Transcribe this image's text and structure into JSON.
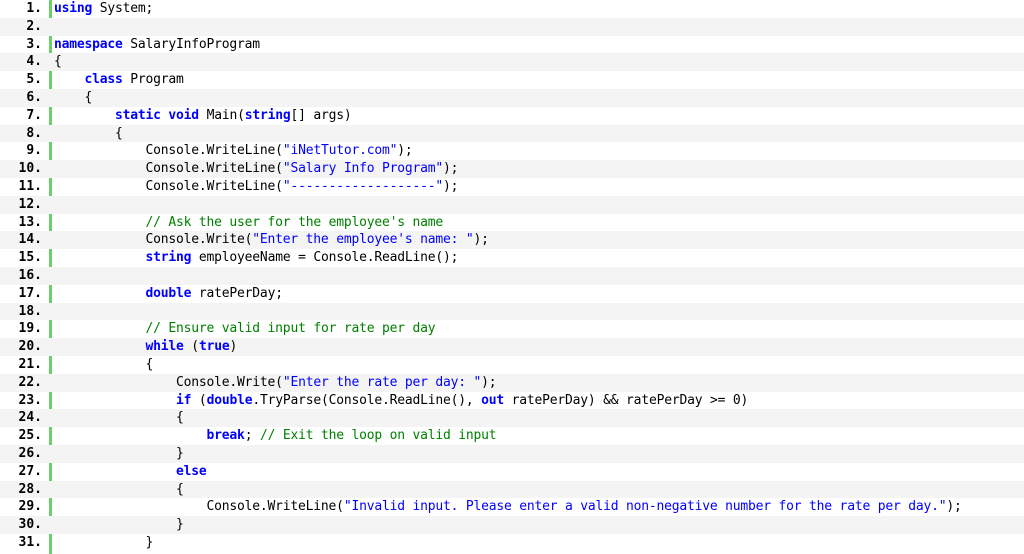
{
  "colors": {
    "keyword": "#0000ff",
    "string": "#0000ff",
    "comment": "#008000",
    "plain": "#000000",
    "gutter_bar": "#6ad16a",
    "stripe": "#f4f4f4"
  },
  "lines": [
    {
      "n": "1.",
      "tokens": [
        {
          "t": "kw",
          "v": "using"
        },
        {
          "t": "pl",
          "v": " System;"
        }
      ]
    },
    {
      "n": "2.",
      "tokens": []
    },
    {
      "n": "3.",
      "tokens": [
        {
          "t": "kw",
          "v": "namespace"
        },
        {
          "t": "pl",
          "v": " SalaryInfoProgram"
        }
      ]
    },
    {
      "n": "4.",
      "tokens": [
        {
          "t": "pl",
          "v": "{"
        }
      ]
    },
    {
      "n": "5.",
      "tokens": [
        {
          "t": "pl",
          "v": "    "
        },
        {
          "t": "kw",
          "v": "class"
        },
        {
          "t": "pl",
          "v": " Program"
        }
      ]
    },
    {
      "n": "6.",
      "tokens": [
        {
          "t": "pl",
          "v": "    {"
        }
      ]
    },
    {
      "n": "7.",
      "tokens": [
        {
          "t": "pl",
          "v": "        "
        },
        {
          "t": "kw",
          "v": "static"
        },
        {
          "t": "pl",
          "v": " "
        },
        {
          "t": "kw",
          "v": "void"
        },
        {
          "t": "pl",
          "v": " Main("
        },
        {
          "t": "kw",
          "v": "string"
        },
        {
          "t": "pl",
          "v": "[] args)"
        }
      ]
    },
    {
      "n": "8.",
      "tokens": [
        {
          "t": "pl",
          "v": "        {"
        }
      ]
    },
    {
      "n": "9.",
      "tokens": [
        {
          "t": "pl",
          "v": "            Console.WriteLine("
        },
        {
          "t": "str",
          "v": "\"iNetTutor.com\""
        },
        {
          "t": "pl",
          "v": ");"
        }
      ]
    },
    {
      "n": "10.",
      "tokens": [
        {
          "t": "pl",
          "v": "            Console.WriteLine("
        },
        {
          "t": "str",
          "v": "\"Salary Info Program\""
        },
        {
          "t": "pl",
          "v": ");"
        }
      ]
    },
    {
      "n": "11.",
      "tokens": [
        {
          "t": "pl",
          "v": "            Console.WriteLine("
        },
        {
          "t": "str",
          "v": "\"-------------------\""
        },
        {
          "t": "pl",
          "v": ");"
        }
      ]
    },
    {
      "n": "12.",
      "tokens": []
    },
    {
      "n": "13.",
      "tokens": [
        {
          "t": "pl",
          "v": "            "
        },
        {
          "t": "cm",
          "v": "// Ask the user for the employee's name"
        }
      ]
    },
    {
      "n": "14.",
      "tokens": [
        {
          "t": "pl",
          "v": "            Console.Write("
        },
        {
          "t": "str",
          "v": "\"Enter the employee's name: \""
        },
        {
          "t": "pl",
          "v": ");"
        }
      ]
    },
    {
      "n": "15.",
      "tokens": [
        {
          "t": "pl",
          "v": "            "
        },
        {
          "t": "kw",
          "v": "string"
        },
        {
          "t": "pl",
          "v": " employeeName = Console.ReadLine();"
        }
      ]
    },
    {
      "n": "16.",
      "tokens": []
    },
    {
      "n": "17.",
      "tokens": [
        {
          "t": "pl",
          "v": "            "
        },
        {
          "t": "kw",
          "v": "double"
        },
        {
          "t": "pl",
          "v": " ratePerDay;"
        }
      ]
    },
    {
      "n": "18.",
      "tokens": []
    },
    {
      "n": "19.",
      "tokens": [
        {
          "t": "pl",
          "v": "            "
        },
        {
          "t": "cm",
          "v": "// Ensure valid input for rate per day"
        }
      ]
    },
    {
      "n": "20.",
      "tokens": [
        {
          "t": "pl",
          "v": "            "
        },
        {
          "t": "kw",
          "v": "while"
        },
        {
          "t": "pl",
          "v": " ("
        },
        {
          "t": "kw",
          "v": "true"
        },
        {
          "t": "pl",
          "v": ")"
        }
      ]
    },
    {
      "n": "21.",
      "tokens": [
        {
          "t": "pl",
          "v": "            {"
        }
      ]
    },
    {
      "n": "22.",
      "tokens": [
        {
          "t": "pl",
          "v": "                Console.Write("
        },
        {
          "t": "str",
          "v": "\"Enter the rate per day: \""
        },
        {
          "t": "pl",
          "v": ");"
        }
      ]
    },
    {
      "n": "23.",
      "tokens": [
        {
          "t": "pl",
          "v": "                "
        },
        {
          "t": "kw",
          "v": "if"
        },
        {
          "t": "pl",
          "v": " ("
        },
        {
          "t": "kw",
          "v": "double"
        },
        {
          "t": "pl",
          "v": ".TryParse(Console.ReadLine(), "
        },
        {
          "t": "kw",
          "v": "out"
        },
        {
          "t": "pl",
          "v": " ratePerDay) && ratePerDay >= 0)"
        }
      ]
    },
    {
      "n": "24.",
      "tokens": [
        {
          "t": "pl",
          "v": "                {"
        }
      ]
    },
    {
      "n": "25.",
      "tokens": [
        {
          "t": "pl",
          "v": "                    "
        },
        {
          "t": "kw",
          "v": "break"
        },
        {
          "t": "pl",
          "v": "; "
        },
        {
          "t": "cm",
          "v": "// Exit the loop on valid input"
        }
      ]
    },
    {
      "n": "26.",
      "tokens": [
        {
          "t": "pl",
          "v": "                }"
        }
      ]
    },
    {
      "n": "27.",
      "tokens": [
        {
          "t": "pl",
          "v": "                "
        },
        {
          "t": "kw",
          "v": "else"
        }
      ]
    },
    {
      "n": "28.",
      "tokens": [
        {
          "t": "pl",
          "v": "                {"
        }
      ]
    },
    {
      "n": "29.",
      "tokens": [
        {
          "t": "pl",
          "v": "                    Console.WriteLine("
        },
        {
          "t": "str",
          "v": "\"Invalid input. Please enter a valid non-negative number for the rate per day.\""
        },
        {
          "t": "pl",
          "v": ");"
        }
      ]
    },
    {
      "n": "30.",
      "tokens": [
        {
          "t": "pl",
          "v": "                }"
        }
      ]
    },
    {
      "n": "31.",
      "tokens": [
        {
          "t": "pl",
          "v": "            }"
        }
      ]
    }
  ]
}
